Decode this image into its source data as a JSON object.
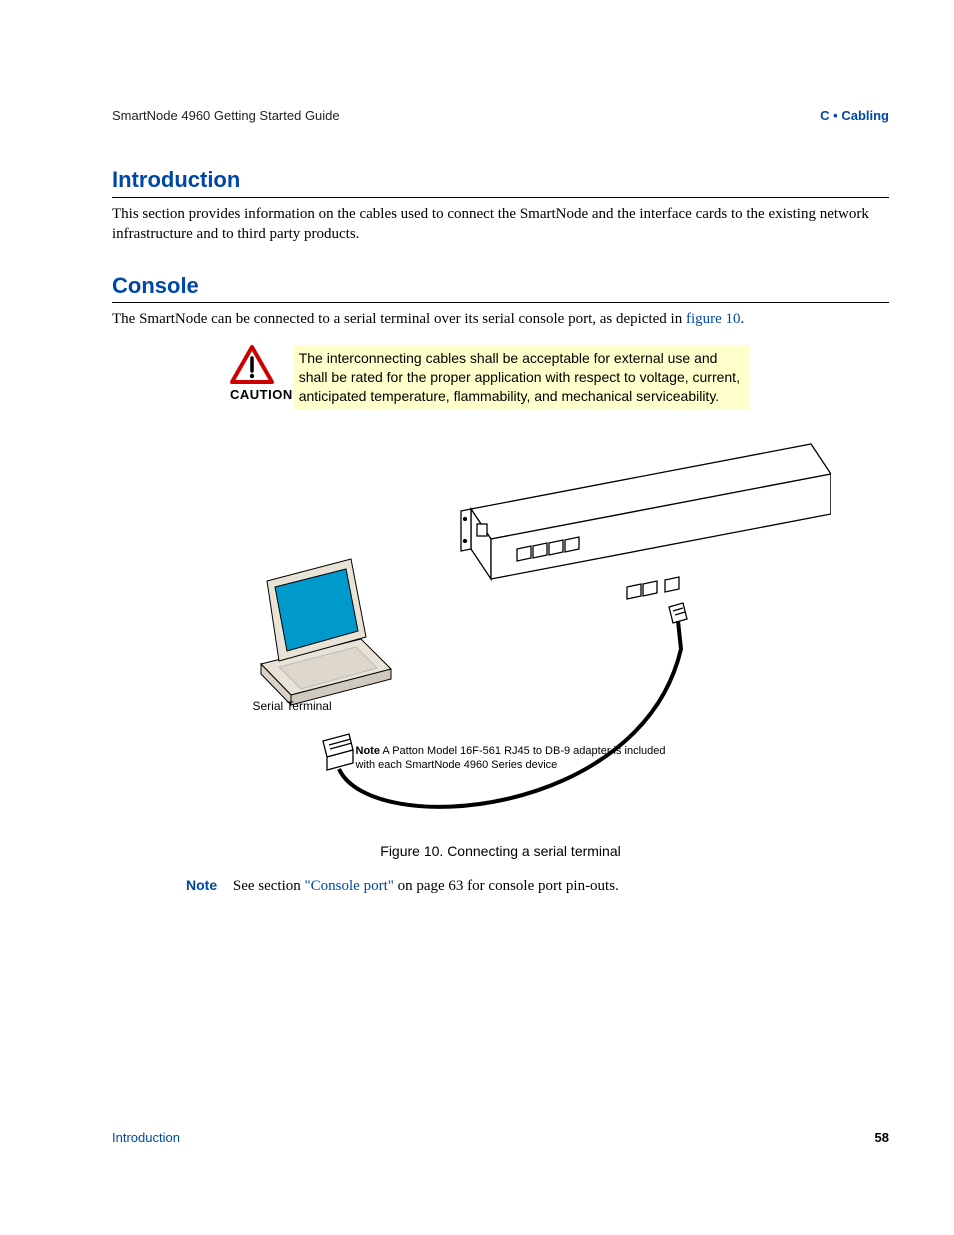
{
  "header": {
    "left": "SmartNode 4960 Getting Started Guide",
    "right": "C • Cabling"
  },
  "section_intro": {
    "heading": "Introduction",
    "body": "This section provides information on the cables used to connect the SmartNode and the interface cards to the existing network infrastructure and to third party products."
  },
  "section_console": {
    "heading": "Console",
    "body_prefix": "The SmartNode can be connected to a serial terminal over its serial console port, as depicted in ",
    "body_link": "figure 10",
    "body_suffix": "."
  },
  "caution": {
    "label": "CAUTION",
    "text": "The interconnecting cables shall be acceptable for external use and shall be rated for the proper application with respect to voltage, current, anticipated temperature, flammability, and mechanical serviceability."
  },
  "figure": {
    "terminal_label": "Serial Terminal",
    "note_label": "Note",
    "note_text": "A Patton Model 16F-561 RJ45 to DB-9 adapter is included with each SmartNode 4960 Series device",
    "caption": "Figure 10. Connecting a serial terminal"
  },
  "bottom_note": {
    "label": "Note",
    "prefix": "See section ",
    "link": "\"Console port\"",
    "suffix": " on page 63 for console port pin-outs."
  },
  "footer": {
    "left": "Introduction",
    "right": "58"
  },
  "colors": {
    "brand_blue": "#0048a8",
    "caution_bg": "#ffffcc",
    "laptop_screen": "#0099cc"
  }
}
